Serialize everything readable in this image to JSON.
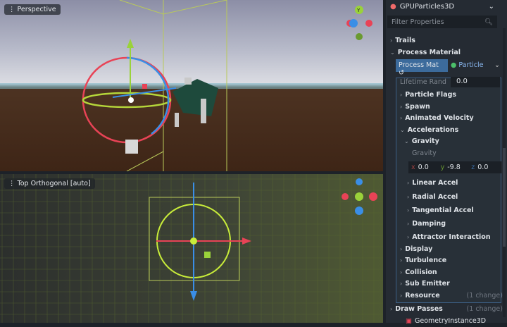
{
  "viewports": {
    "perspective": "Perspective",
    "top": "Top Orthogonal [auto]"
  },
  "gizmo_axes": {
    "x": "X",
    "y": "Y",
    "z": "Z"
  },
  "colors": {
    "accent": "#3c6b9c",
    "x": "#e84356",
    "y": "#9ad23a",
    "z": "#3a8ee6"
  },
  "inspector": {
    "node": "GPUParticles3D",
    "filter_placeholder": "Filter Properties",
    "sections": {
      "trails": "Trails",
      "process_material": "Process Material"
    },
    "material_tab": "Process Mat",
    "material_type": "Particle",
    "lifetime_rand_label": "Lifetime Rand",
    "lifetime_rand_value": "0.0",
    "groups": [
      "Particle Flags",
      "Spawn",
      "Animated Velocity",
      "Accelerations"
    ],
    "gravity_group": "Gravity",
    "gravity_label": "Gravity",
    "gravity": {
      "x_label": "x",
      "x": "0.0",
      "y_label": "y",
      "y": "-9.8",
      "z_label": "z",
      "z": "0.0"
    },
    "subgroups": [
      "Linear Accel",
      "Radial Accel",
      "Tangential Accel",
      "Damping",
      "Attractor Interaction"
    ],
    "more_groups": [
      "Display",
      "Turbulence",
      "Collision",
      "Sub Emitter"
    ],
    "resource": "Resource",
    "resource_change": "(1 change)",
    "draw_passes": "Draw Passes",
    "draw_passes_change": "(1 change)",
    "geometry": "GeometryInstance3D"
  }
}
